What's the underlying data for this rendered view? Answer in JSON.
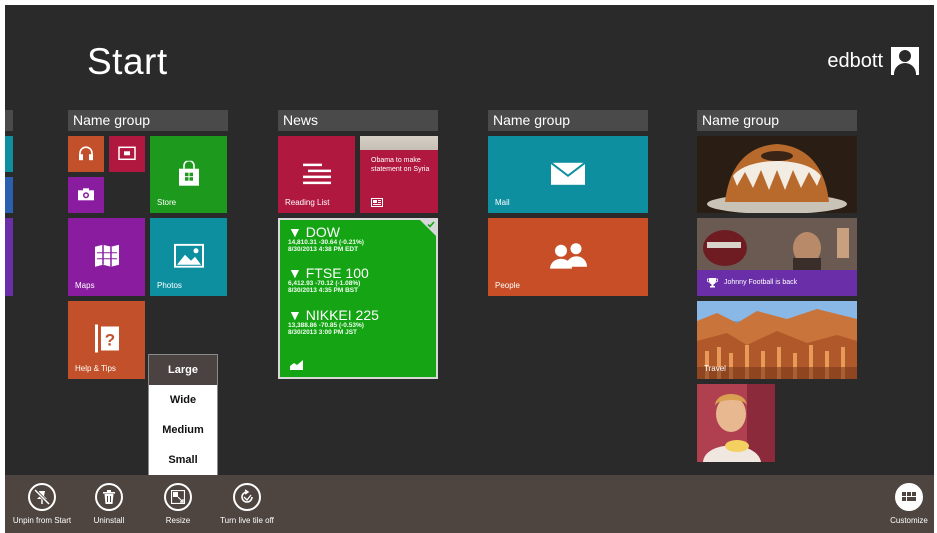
{
  "start": {
    "title": "Start"
  },
  "user": {
    "name": "edbott",
    "icon": "user-avatar-icon"
  },
  "groups": [
    {
      "label": "Name group"
    },
    {
      "label": "News"
    },
    {
      "label": "Name group"
    },
    {
      "label": "Name group"
    }
  ],
  "tiles": {
    "store": "Store",
    "maps": "Maps",
    "photos": "Photos",
    "help": "Help & Tips",
    "reading_list": "Reading List",
    "news_headline": "Obama to make statement on Syria",
    "mail": "Mail",
    "people": "People",
    "sports_headline": "Johnny Football is back",
    "travel": "Travel"
  },
  "finance": [
    {
      "name": "▼ DOW",
      "change": "14,810.31 -30.64 (-0.21%)",
      "time": "8/30/2013 4:38 PM EDT"
    },
    {
      "name": "▼ FTSE 100",
      "change": "6,412.93 -70.12 (-1.08%)",
      "time": "8/30/2013 4:35 PM BST"
    },
    {
      "name": "▼ NIKKEI 225",
      "change": "13,388.86 -70.85 (-0.53%)",
      "time": "8/30/2013 3:00 PM JST"
    }
  ],
  "resize_menu": {
    "options": [
      {
        "label": "Large",
        "selected": true
      },
      {
        "label": "Wide",
        "selected": false
      },
      {
        "label": "Medium",
        "selected": false
      },
      {
        "label": "Small",
        "selected": false
      }
    ]
  },
  "appbar": {
    "unpin": "Unpin from Start",
    "uninstall": "Uninstall",
    "resize": "Resize",
    "live_tile": "Turn live tile off",
    "customize": "Customize"
  },
  "colors": {
    "background": "#2a2a2a",
    "store_green": "#1d9a1d",
    "maps_purple": "#8a1d9f",
    "photos_teal": "#0e8fa0",
    "help_orange": "#c2502a",
    "reading_red": "#b0183f",
    "finance_green": "#14a414",
    "mail_teal": "#0e8fa0",
    "people_orange": "#c74e27",
    "sports_purple": "#6a2fa8",
    "appbar": "#4e4440"
  }
}
